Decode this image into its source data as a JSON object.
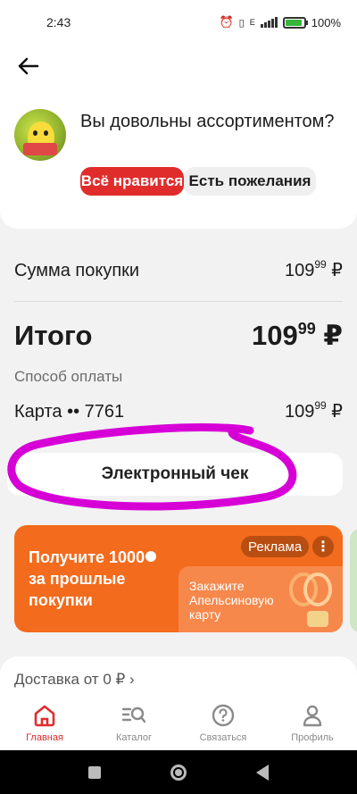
{
  "status_bar": {
    "time": "2:43",
    "battery_percent": "100%",
    "network": "E"
  },
  "feedback": {
    "question": "Вы довольны ассортиментом?",
    "like_button": "Всё нравится",
    "wish_button": "Есть пожелания"
  },
  "summary": {
    "purchase_label": "Сумма покупки",
    "purchase_int": "109",
    "purchase_dec": "99",
    "currency": "₽",
    "total_label": "Итого",
    "total_int": "109",
    "total_dec": "99",
    "payment_method_label": "Способ оплаты",
    "card_label": "Карта •• 7761",
    "card_int": "109",
    "card_dec": "99"
  },
  "receipt_button": "Электронный чек",
  "promo": {
    "line1": "Получите 1000",
    "line2": "за прошлые",
    "line3": "покупки",
    "ad_badge": "Реклама",
    "card_text": "Закажите Апельсиновую карту"
  },
  "delivery": {
    "text": "Доставка от 0 ₽ ›"
  },
  "tabs": [
    {
      "label": "Главная",
      "icon": "home-icon",
      "active": true
    },
    {
      "label": "Каталог",
      "icon": "catalog-search-icon",
      "active": false
    },
    {
      "label": "Связаться",
      "icon": "question-chat-icon",
      "active": false
    },
    {
      "label": "Профиль",
      "icon": "profile-icon",
      "active": false
    }
  ],
  "colors": {
    "accent_red": "#e12c2c",
    "promo_orange": "#f36b1c",
    "annotation_magenta": "#d600d6"
  }
}
